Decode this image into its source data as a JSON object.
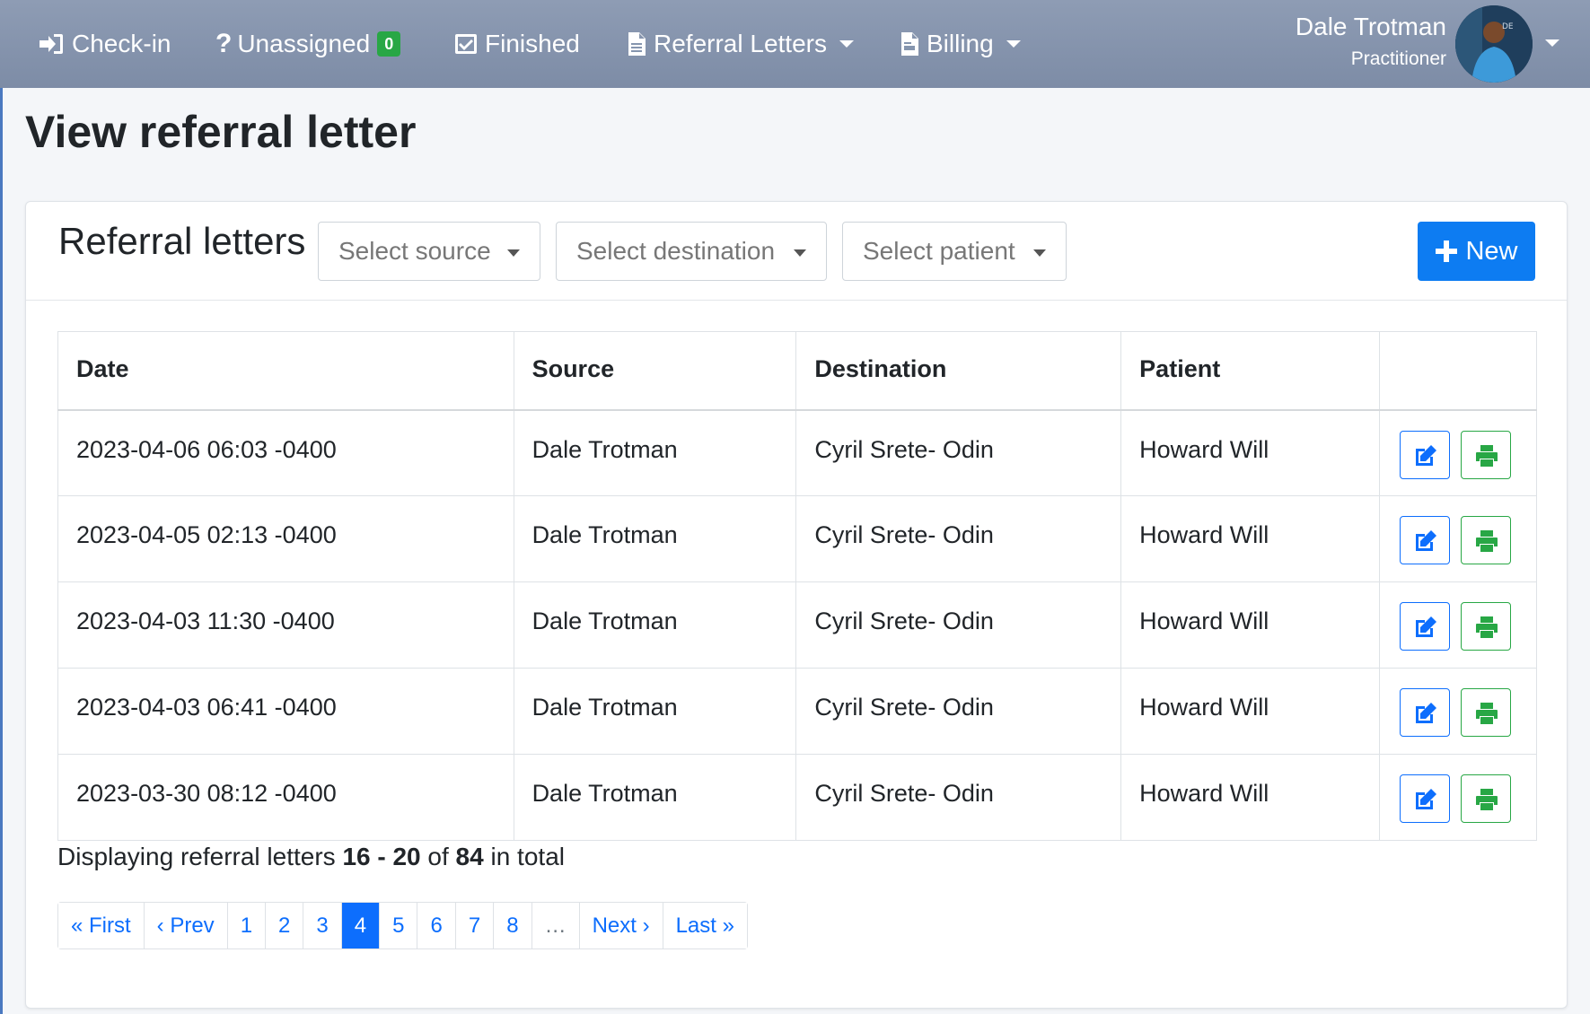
{
  "nav": {
    "checkin": "Check-in",
    "unassigned": "Unassigned",
    "unassigned_count": "0",
    "finished": "Finished",
    "referral_letters": "Referral Letters",
    "billing": "Billing"
  },
  "user": {
    "name": "Dale Trotman",
    "role": "Practitioner"
  },
  "page_title": "View referral letter",
  "card": {
    "title": "Referral letters",
    "source_placeholder": "Select source",
    "destination_placeholder": "Select destination",
    "patient_placeholder": "Select patient",
    "new_label": "New"
  },
  "table": {
    "headers": [
      "Date",
      "Source",
      "Destination",
      "Patient",
      ""
    ],
    "rows": [
      {
        "date": "2023-04-06 06:03 -0400",
        "source": "Dale Trotman",
        "destination": "Cyril Srete- Odin",
        "patient": "Howard Will"
      },
      {
        "date": "2023-04-05 02:13 -0400",
        "source": "Dale Trotman",
        "destination": "Cyril Srete- Odin",
        "patient": "Howard Will"
      },
      {
        "date": "2023-04-03 11:30 -0400",
        "source": "Dale Trotman",
        "destination": "Cyril Srete- Odin",
        "patient": "Howard Will"
      },
      {
        "date": "2023-04-03 06:41 -0400",
        "source": "Dale Trotman",
        "destination": "Cyril Srete- Odin",
        "patient": "Howard Will"
      },
      {
        "date": "2023-03-30 08:12 -0400",
        "source": "Dale Trotman",
        "destination": "Cyril Srete- Odin",
        "patient": "Howard Will"
      }
    ]
  },
  "summary": {
    "prefix": "Displaying referral letters",
    "range": "16 - 20",
    "of": "of",
    "total": "84",
    "suffix": "in total"
  },
  "pagination": {
    "first": "« First",
    "prev": "‹ Prev",
    "pages": [
      "1",
      "2",
      "3",
      "4",
      "5",
      "6",
      "7",
      "8"
    ],
    "current": "4",
    "gap": "…",
    "next": "Next ›",
    "last": "Last »"
  },
  "colors": {
    "primary": "#0d6efd",
    "success": "#28a745",
    "navbar": "#8595ae"
  }
}
